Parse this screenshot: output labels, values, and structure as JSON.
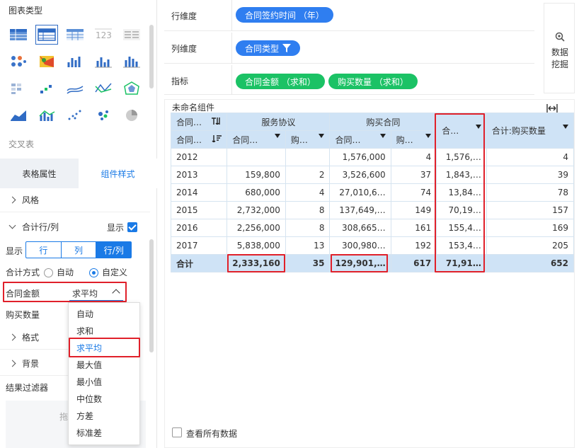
{
  "left": {
    "chart_type_title": "图表类型",
    "cross_table_label": "交叉表",
    "tabs": [
      {
        "label": "表格属性",
        "active": false
      },
      {
        "label": "组件样式",
        "active": true
      }
    ],
    "style_label": "风格",
    "total_row_col_label": "合计行/列",
    "show_label": "显示",
    "show_checked": true,
    "display_label": "显示",
    "seg_options": [
      "行",
      "列",
      "行/列"
    ],
    "seg_active": 2,
    "total_method_label": "合计方式",
    "radio_auto": "自动",
    "radio_custom": "自定义",
    "field_amount": "合同金额",
    "field_amount_value": "求平均",
    "field_qty": "购买数量",
    "format_label": "格式",
    "background_label": "背景",
    "filter_label": "结果过滤器",
    "filter_placeholder": "拖",
    "dropdown_items": [
      "自动",
      "求和",
      "求平均",
      "最大值",
      "最小值",
      "中位数",
      "方差",
      "标准差"
    ],
    "dropdown_selected": 2
  },
  "dims": {
    "row_label": "行维度",
    "row_pill": "合同签约时间 （年）",
    "col_label": "列维度",
    "col_pill": "合同类型",
    "metric_label": "指标",
    "metric_pills": [
      "合同金额 （求和）",
      "购买数量 （求和）"
    ],
    "mine_label_1": "数据",
    "mine_label_2": "挖掘"
  },
  "table": {
    "title": "未命名组件",
    "h1": {
      "c0": "合同…",
      "g1": "服务协议",
      "g2": "购买合同",
      "c5": "合…",
      "c6": "合计:购买数量"
    },
    "h2": {
      "c0": "合同…",
      "c1": "合同…",
      "c2": "购…",
      "c3": "合同…",
      "c4": "购…"
    },
    "rows": [
      [
        "2012",
        "",
        "",
        "1,576,000",
        "4",
        "1,576,…",
        "4"
      ],
      [
        "2013",
        "159,800",
        "2",
        "3,526,600",
        "37",
        "1,843,…",
        "39"
      ],
      [
        "2014",
        "680,000",
        "4",
        "27,010,6…",
        "74",
        "13,84…",
        "78"
      ],
      [
        "2015",
        "2,732,000",
        "8",
        "137,649,…",
        "149",
        "70,19…",
        "157"
      ],
      [
        "2016",
        "2,256,000",
        "8",
        "308,665…",
        "161",
        "155,4…",
        "169"
      ],
      [
        "2017",
        "5,838,000",
        "13",
        "300,980…",
        "192",
        "153,4…",
        "205"
      ]
    ],
    "total": [
      "合计",
      "2,333,160",
      "35",
      "129,901,…",
      "617",
      "71,91…",
      "652"
    ],
    "view_all": "查看所有数据"
  },
  "colors": {
    "accent": "#1a7ae6",
    "pill_blue": "#2f7ef0",
    "pill_green": "#1bc265",
    "highlight": "#e0202a",
    "header_bg": "#cfe3f6"
  }
}
